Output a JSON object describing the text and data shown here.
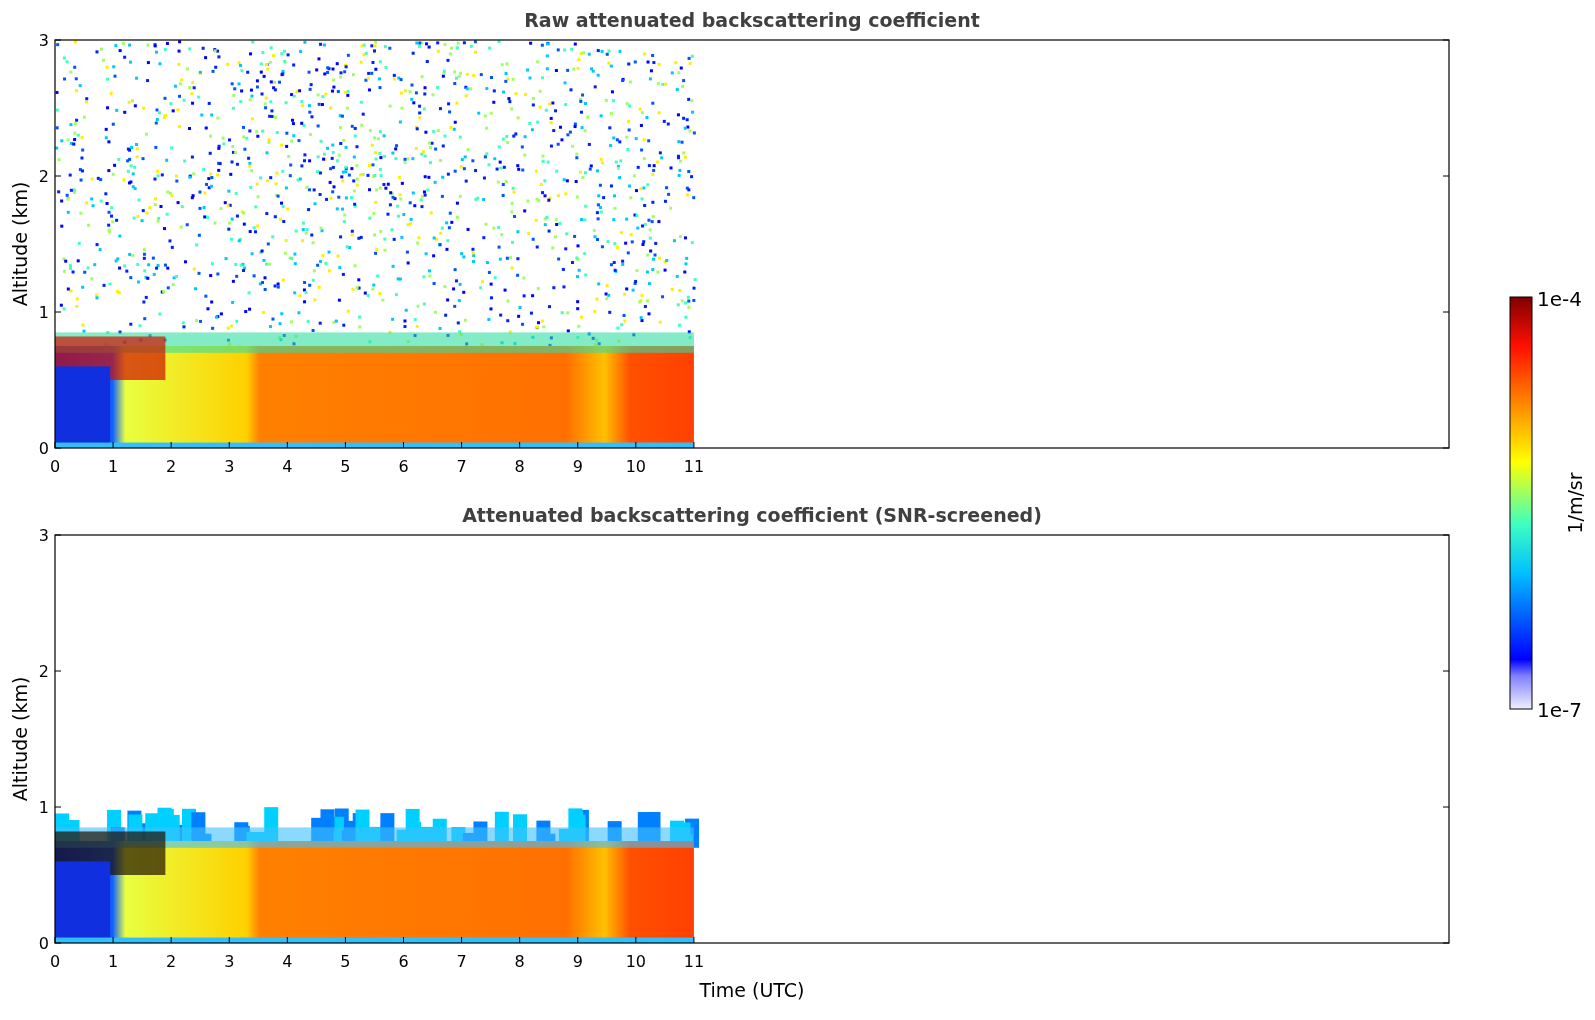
{
  "panels": [
    {
      "kind": "raw",
      "title": "Raw attenuated backscattering coefficient",
      "ylabel": "Altitude (km)",
      "yticks": [
        "3",
        "2",
        "1",
        "0"
      ],
      "xticks": [
        "0",
        "1",
        "2",
        "3",
        "4",
        "5",
        "6",
        "7",
        "8",
        "9",
        "10",
        "11"
      ]
    },
    {
      "kind": "screened",
      "title": "Attenuated backscattering coefficient (SNR-screened)",
      "ylabel": "Altitude (km)",
      "yticks": [
        "3",
        "2",
        "1",
        "0"
      ],
      "xticks": [
        "0",
        "1",
        "2",
        "3",
        "4",
        "5",
        "6",
        "7",
        "8",
        "9",
        "10",
        "11"
      ],
      "xlabel": "Time (UTC)"
    }
  ],
  "colorbar": {
    "max_label": "1e-4",
    "min_label": "1e-7",
    "unit_label": "1/m/sr"
  }
}
